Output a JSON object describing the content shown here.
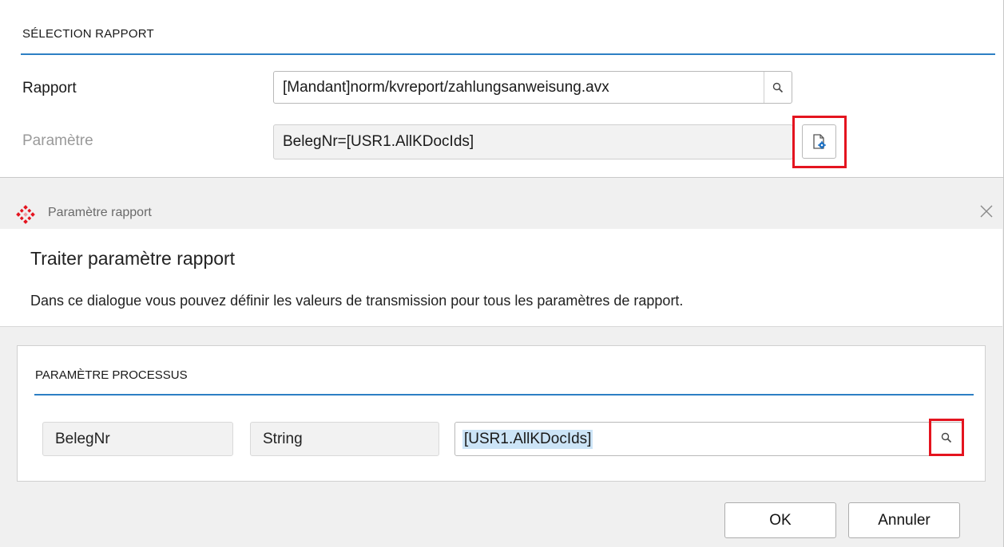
{
  "report_selection": {
    "section_title": "SÉLECTION RAPPORT",
    "report_label": "Rapport",
    "report_value": "[Mandant]norm/kvreport/zahlungsanweisung.avx",
    "parameter_label": "Paramètre",
    "parameter_value": "BelegNr=[USR1.AllKDocIds]"
  },
  "dialog": {
    "window_title": "Paramètre rapport",
    "heading": "Traiter paramètre rapport",
    "description": "Dans ce dialogue vous pouvez définir les valeurs de transmission pour tous les paramètres de rapport.",
    "section_title": "PARAMÈTRE PROCESSUS",
    "param_row": {
      "name": "BelegNr",
      "type": "String",
      "value": "[USR1.AllKDocIds]"
    },
    "ok_label": "OK",
    "cancel_label": "Annuler"
  },
  "colors": {
    "accent_line": "#2d7fc4",
    "highlight_box": "#e4141f",
    "selection": "#cce4f7"
  }
}
